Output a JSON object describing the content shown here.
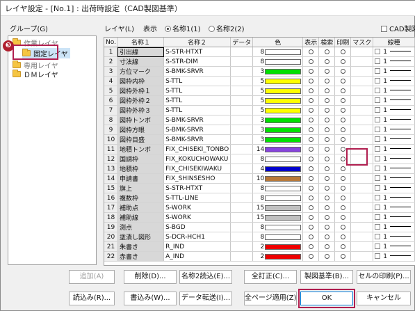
{
  "window": {
    "title": "レイヤ設定 - [No.1] : 出荷時設定（CAD製図基準）"
  },
  "group": {
    "label": "グループ(G)",
    "items": [
      "作業レイヤ",
      "固定レイヤ",
      "専用レイヤ",
      "ＤＭレイヤ"
    ],
    "badge": "❸"
  },
  "layer": {
    "label": "レイヤ(L)",
    "display_label": "表示",
    "radio1": "名称1(1)",
    "radio2": "名称2(2)",
    "cad_check": "CAD製図"
  },
  "columns": [
    "No.",
    "名称１",
    "名称２",
    "データ",
    "色",
    "表示",
    "検索",
    "印刷",
    "マスク",
    "線種"
  ],
  "rows": [
    {
      "no": "1",
      "n1": "引出線",
      "n2": "S-STR-HTXT",
      "c": "8",
      "color": "#ffffff"
    },
    {
      "no": "2",
      "n1": "寸法線",
      "n2": "S-STR-DIM",
      "c": "8",
      "color": "#ffffff"
    },
    {
      "no": "3",
      "n1": "方位マーク",
      "n2": "S-BMK-SRVR",
      "c": "3",
      "color": "#00e000"
    },
    {
      "no": "4",
      "n1": "図枠内枠",
      "n2": "S-TTL",
      "c": "5",
      "color": "#ffff00"
    },
    {
      "no": "5",
      "n1": "図枠外枠１",
      "n2": "S-TTL",
      "c": "5",
      "color": "#ffff00"
    },
    {
      "no": "6",
      "n1": "図枠外枠２",
      "n2": "S-TTL",
      "c": "5",
      "color": "#ffff00"
    },
    {
      "no": "7",
      "n1": "図枠外枠３",
      "n2": "S-TTL",
      "c": "5",
      "color": "#ffff00"
    },
    {
      "no": "8",
      "n1": "図枠トンボ",
      "n2": "S-BMK-SRVR",
      "c": "3",
      "color": "#00e000"
    },
    {
      "no": "9",
      "n1": "図枠方眼",
      "n2": "S-BMK-SRVR",
      "c": "3",
      "color": "#00e000"
    },
    {
      "no": "10",
      "n1": "図枠目盛",
      "n2": "S-BMK-SRVR",
      "c": "3",
      "color": "#00e000"
    },
    {
      "no": "11",
      "n1": "地積トンボ",
      "n2": "FIX_CHISEKI_TONBO",
      "c": "14",
      "color": "#8844dd"
    },
    {
      "no": "12",
      "n1": "国調枠",
      "n2": "FIX_KOKUCHOWAKU",
      "c": "8",
      "color": "#ffffff"
    },
    {
      "no": "13",
      "n1": "地積枠",
      "n2": "FIX_CHISEKIWAKU",
      "c": "4",
      "color": "#0000cc"
    },
    {
      "no": "14",
      "n1": "申請書",
      "n2": "FIX_SHINSESHO",
      "c": "10",
      "color": "#b87838"
    },
    {
      "no": "15",
      "n1": "旗上",
      "n2": "S-STR-HTXT",
      "c": "8",
      "color": "#ffffff"
    },
    {
      "no": "16",
      "n1": "複数枠",
      "n2": "S-TTL-LINE",
      "c": "8",
      "color": "#ffffff"
    },
    {
      "no": "17",
      "n1": "補助点",
      "n2": "S-WORK",
      "c": "15",
      "color": "#c0c0c0"
    },
    {
      "no": "18",
      "n1": "補助線",
      "n2": "S-WORK",
      "c": "15",
      "color": "#c0c0c0"
    },
    {
      "no": "19",
      "n1": "測点",
      "n2": "S-BGD",
      "c": "8",
      "color": "#ffffff"
    },
    {
      "no": "20",
      "n1": "塗潰し図形",
      "n2": "S-DCR-HCH1",
      "c": "8",
      "color": "#ffffff"
    },
    {
      "no": "21",
      "n1": "朱書き",
      "n2": "R_IND",
      "c": "2",
      "color": "#ee0000"
    },
    {
      "no": "22",
      "n1": "赤書き",
      "n2": "A_IND",
      "c": "2",
      "color": "#ee0000"
    }
  ],
  "mark_symbol": "○",
  "linetype_value": "1",
  "buttons": {
    "add": "追加(A)",
    "delete": "削除(D)...",
    "name2read": "名称2読込(E)...",
    "all_correct": "全訂正(C)...",
    "standard": "製図基準(B)...",
    "cell_print": "セルの印刷(P)...",
    "read": "読込み(R)...",
    "write": "書込み(W)...",
    "transfer": "データ転送(I)...",
    "apply_all": "全ページ適用(Z)",
    "ok": "OK",
    "cancel": "キャンセル"
  }
}
